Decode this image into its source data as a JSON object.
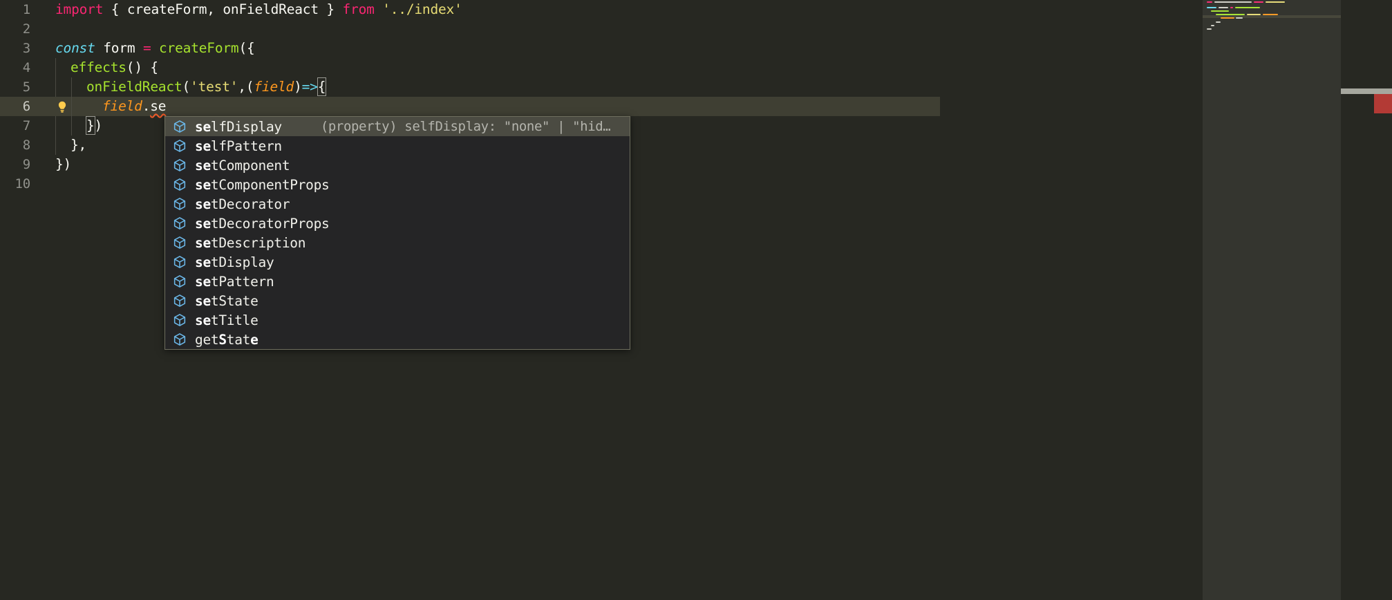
{
  "editor": {
    "theme_background": "#272822",
    "current_line_background": "#3f3f33",
    "line_count": 10,
    "current_line": 6,
    "cursor_column": 16,
    "lines": [
      {
        "number": "1",
        "text": "import { createForm, onFieldReact } from '../index'"
      },
      {
        "number": "2",
        "text": ""
      },
      {
        "number": "3",
        "text": "const form = createForm({"
      },
      {
        "number": "4",
        "text": "  effects() {"
      },
      {
        "number": "5",
        "text": "    onFieldReact('test',(field)=>{"
      },
      {
        "number": "6",
        "text": "      field.se"
      },
      {
        "number": "7",
        "text": "    })"
      },
      {
        "number": "8",
        "text": "  },"
      },
      {
        "number": "9",
        "text": "})"
      },
      {
        "number": "10",
        "text": ""
      }
    ],
    "tokens": {
      "import_kw": "import",
      "brace_open": " { ",
      "named_import_1": "createForm",
      "comma": ", ",
      "named_import_2": "onFieldReact",
      "brace_close": " } ",
      "from_kw": "from",
      "module_path": "'../index'",
      "const_kw": "const",
      "form_ident": " form ",
      "equals": "=",
      "create_form_call": " createForm",
      "paren_brace_open": "({",
      "effects_ident": "effects",
      "effects_sig": "() {",
      "on_field_react": "onFieldReact",
      "paren_open": "(",
      "test_string": "'test'",
      "comma2": ",(",
      "field_param": "field",
      "paren_close_arrow": ")",
      "fat_arrow": "=>",
      "arrow_brace": "{",
      "field_ident": "field",
      "dot": ".",
      "partial_member": "se",
      "close_paren_brace": "})",
      "close_obj_comma": "},",
      "close_call": "})"
    },
    "gutter": {
      "quickfix_icon": "lightbulb-icon",
      "quickfix_line": 6
    },
    "error_marker_color": "#b33a35"
  },
  "suggest": {
    "selected_index": 0,
    "matched_prefix": "se",
    "icon_name": "property-cube-icon",
    "icon_color": "#6bb7e8",
    "selected_detail": "(property) selfDisplay: \"none\" | \"hid…",
    "items": [
      {
        "pre": "se",
        "post": "lfDisplay",
        "icon": "property-cube-icon"
      },
      {
        "pre": "se",
        "post": "lfPattern",
        "icon": "property-cube-icon"
      },
      {
        "pre": "se",
        "post": "tComponent",
        "icon": "property-cube-icon"
      },
      {
        "pre": "se",
        "post": "tComponentProps",
        "icon": "property-cube-icon"
      },
      {
        "pre": "se",
        "post": "tDecorator",
        "icon": "property-cube-icon"
      },
      {
        "pre": "se",
        "post": "tDecoratorProps",
        "icon": "property-cube-icon"
      },
      {
        "pre": "se",
        "post": "tDescription",
        "icon": "property-cube-icon"
      },
      {
        "pre": "se",
        "post": "tDisplay",
        "icon": "property-cube-icon"
      },
      {
        "pre": "se",
        "post": "tPattern",
        "icon": "property-cube-icon"
      },
      {
        "pre": "se",
        "post": "tState",
        "icon": "property-cube-icon"
      },
      {
        "pre": "se",
        "post": "tTitle",
        "icon": "property-cube-icon"
      },
      {
        "pre": "",
        "post": "getState",
        "icon": "property-cube-icon",
        "label_full": "getState"
      }
    ]
  },
  "minimap": {
    "visible": true,
    "name": "minimap"
  },
  "scrollbar": {
    "name": "vertical-scrollbar",
    "error_tick_color": "#b33a35"
  }
}
